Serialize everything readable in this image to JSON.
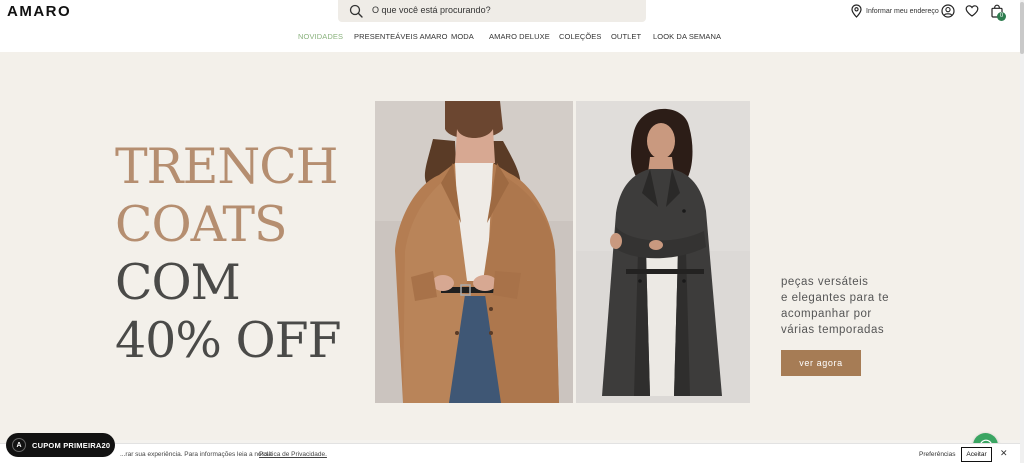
{
  "header": {
    "logo": "AMARO",
    "search_placeholder": "O que você está procurando?",
    "address_label": "Informar meu endereço",
    "bag_count": "0"
  },
  "nav": {
    "items": [
      "NOVIDADES",
      "PRESENTEÁVEIS AMARO",
      "MODA",
      "AMARO DELUXE",
      "COLEÇÕES",
      "OUTLET",
      "LOOK DA SEMANA"
    ],
    "active": "NOVIDADES"
  },
  "hero": {
    "headline": [
      "TRENCH",
      "COATS",
      "COM",
      "40% OFF"
    ],
    "subtitle": [
      "peças versáteis",
      "e elegantes para te",
      "acompanhar por",
      "várias temporadas"
    ],
    "cta": "ver agora"
  },
  "cookie": {
    "text": "...rar sua experiência. Para informações leia a nossa",
    "link": "Política de Privacidade.",
    "preferences": "Preferências",
    "accept": "Aceitar"
  },
  "coupon": {
    "label": "CUPOM PRIMEIRA20",
    "badge": "A"
  },
  "icons": [
    "search-icon",
    "location-pin-icon",
    "user-icon",
    "heart-icon",
    "shopping-bag-icon",
    "whatsapp-icon",
    "close-icon"
  ],
  "colors": {
    "accent_green": "#8ab27d",
    "headline_tan": "#b58e70",
    "headline_gray": "#4a4a48",
    "cta": "#a67c55",
    "whatsapp": "#3aa562",
    "bag_badge": "#2e7d4f"
  }
}
